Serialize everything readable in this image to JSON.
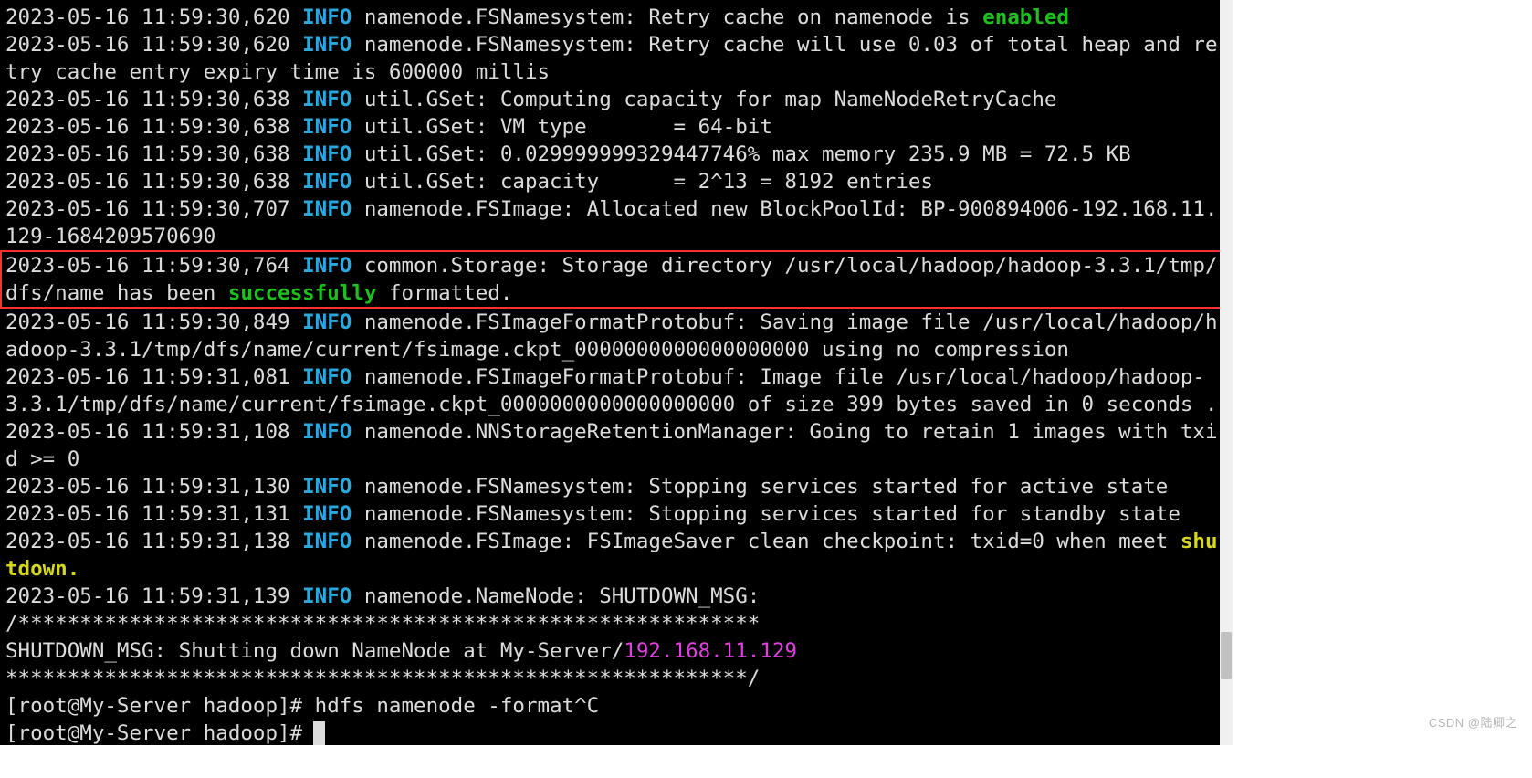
{
  "log": {
    "l0": {
      "ts": "2023-05-16 11:59:30,620",
      "lvl": "INFO",
      "pre": " namenode.FSNamesystem: Retry cache on namenode is ",
      "kw": "enabled"
    },
    "l1": {
      "ts": "2023-05-16 11:59:30,620",
      "lvl": "INFO",
      "msg": " namenode.FSNamesystem: Retry cache will use 0.03 of total heap and retry cache entry expiry time is 600000 millis"
    },
    "l2": {
      "ts": "2023-05-16 11:59:30,638",
      "lvl": "INFO",
      "msg": " util.GSet: Computing capacity for map NameNodeRetryCache"
    },
    "l3": {
      "ts": "2023-05-16 11:59:30,638",
      "lvl": "INFO",
      "msg": " util.GSet: VM type       = 64-bit"
    },
    "l4": {
      "ts": "2023-05-16 11:59:30,638",
      "lvl": "INFO",
      "msg": " util.GSet: 0.029999999329447746% max memory 235.9 MB = 72.5 KB"
    },
    "l5": {
      "ts": "2023-05-16 11:59:30,638",
      "lvl": "INFO",
      "msg": " util.GSet: capacity      = 2^13 = 8192 entries"
    },
    "l6": {
      "ts": "2023-05-16 11:59:30,707",
      "lvl": "INFO",
      "msg": " namenode.FSImage: Allocated new BlockPoolId: BP-900894006-192.168.11.129-1684209570690"
    },
    "l7": {
      "ts": "2023-05-16 11:59:30,764",
      "lvl": "INFO",
      "pre": " common.Storage: Storage directory /usr/local/hadoop/hadoop-3.3.1/tmp/dfs/name has been ",
      "kw": "successfully",
      "post": " formatted."
    },
    "l8": {
      "ts": "2023-05-16 11:59:30,849",
      "lvl": "INFO",
      "msg": " namenode.FSImageFormatProtobuf: Saving image file /usr/local/hadoop/hadoop-3.3.1/tmp/dfs/name/current/fsimage.ckpt_0000000000000000000 using no compression"
    },
    "l9": {
      "ts": "2023-05-16 11:59:31,081",
      "lvl": "INFO",
      "msg": " namenode.FSImageFormatProtobuf: Image file /usr/local/hadoop/hadoop-3.3.1/tmp/dfs/name/current/fsimage.ckpt_0000000000000000000 of size 399 bytes saved in 0 seconds ."
    },
    "l10": {
      "ts": "2023-05-16 11:59:31,108",
      "lvl": "INFO",
      "msg": " namenode.NNStorageRetentionManager: Going to retain 1 images with txid >= 0"
    },
    "l11": {
      "ts": "2023-05-16 11:59:31,130",
      "lvl": "INFO",
      "msg": " namenode.FSNamesystem: Stopping services started for active state"
    },
    "l12": {
      "ts": "2023-05-16 11:59:31,131",
      "lvl": "INFO",
      "msg": " namenode.FSNamesystem: Stopping services started for standby state"
    },
    "l13": {
      "ts": "2023-05-16 11:59:31,138",
      "lvl": "INFO",
      "pre": " namenode.FSImage: FSImageSaver clean checkpoint: txid=0 when meet ",
      "kw": "shutdown",
      "post": "."
    },
    "l14": {
      "ts": "2023-05-16 11:59:31,139",
      "lvl": "INFO",
      "msg": " namenode.NameNode: SHUTDOWN_MSG: "
    }
  },
  "shutdown": {
    "bar_top": "/************************************************************",
    "msg_pre": "SHUTDOWN_MSG: Shutting down NameNode at My-Server/",
    "ip": "192.168.11.129",
    "bar_bot": "************************************************************/"
  },
  "prompt1": {
    "text": "[root@My-Server hadoop]# ",
    "cmd": "hdfs namenode -format^C"
  },
  "prompt2": {
    "text": "[root@My-Server hadoop]# "
  },
  "watermark": "CSDN @陆卿之"
}
